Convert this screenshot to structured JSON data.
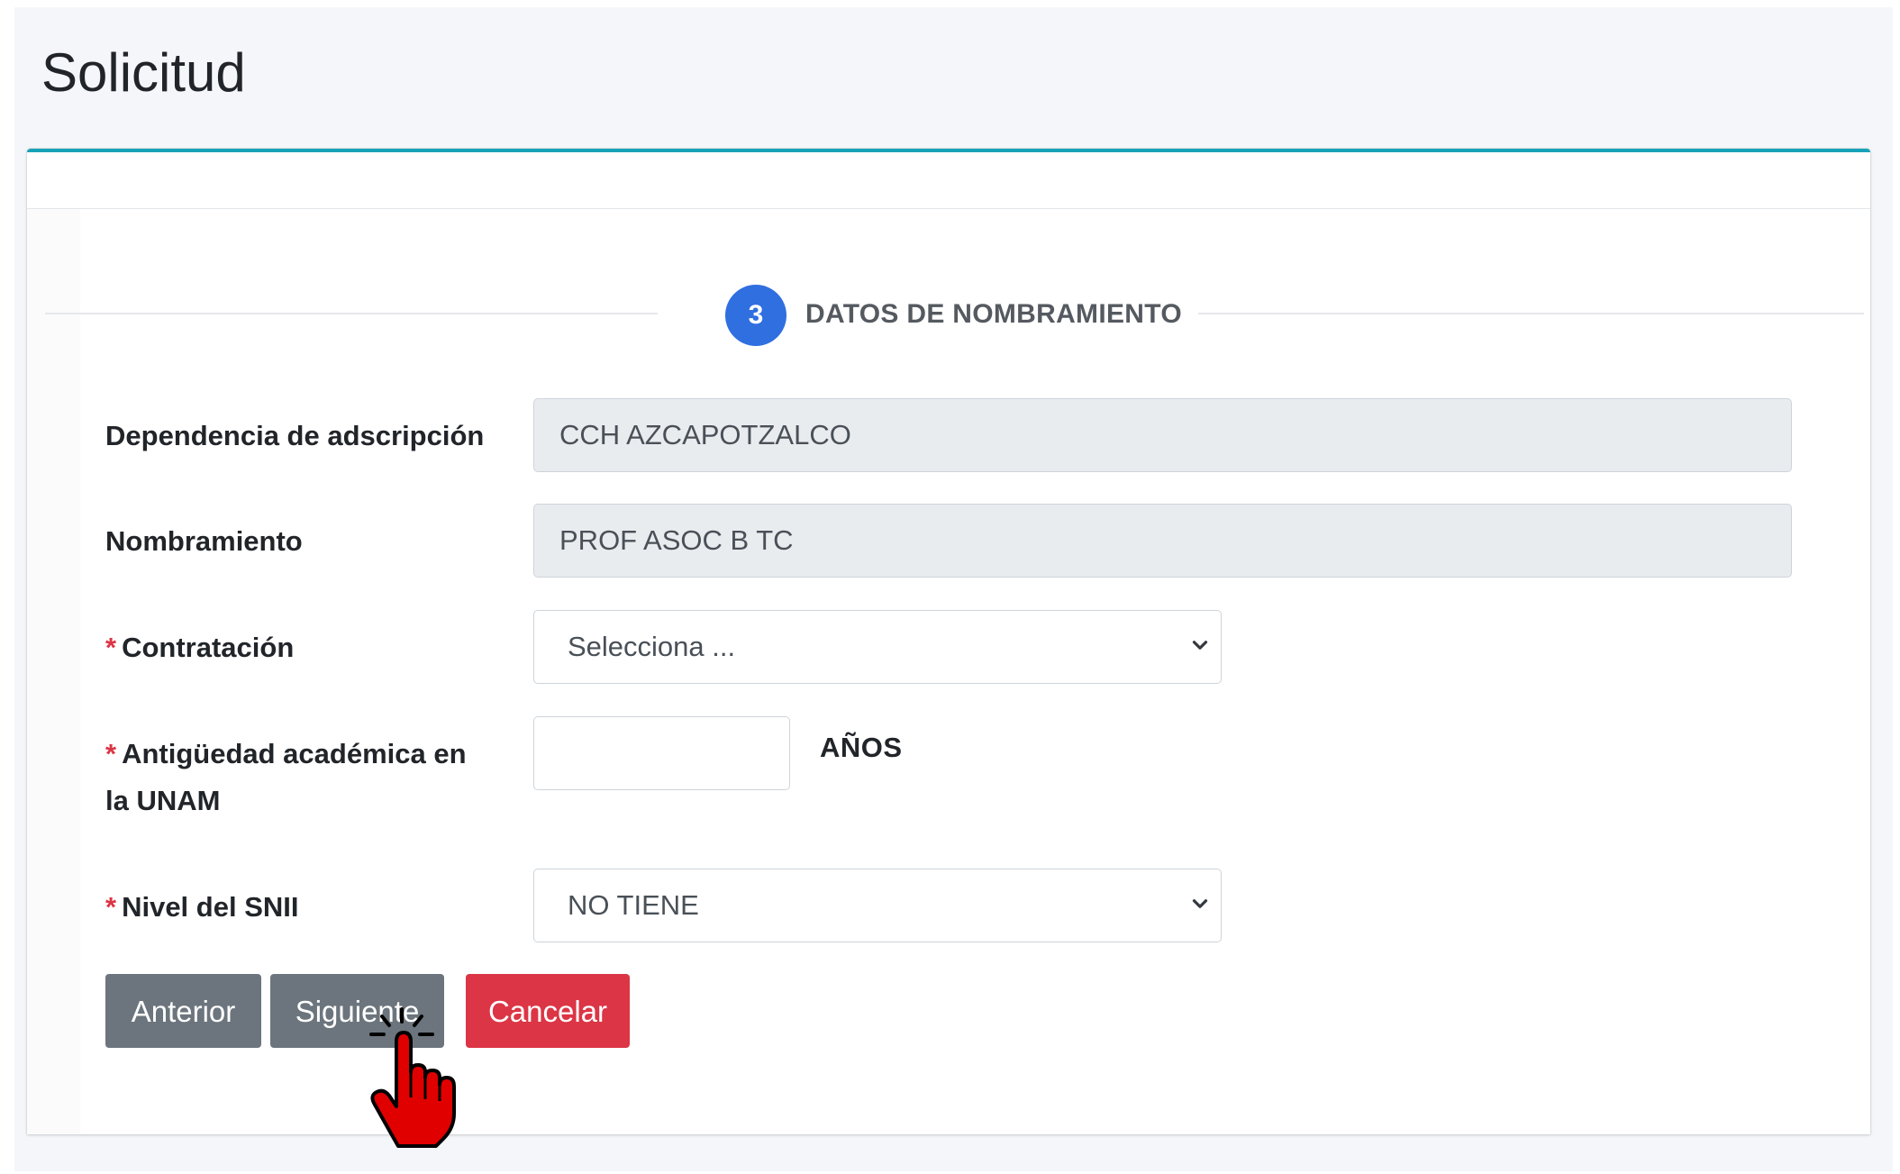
{
  "page": {
    "title": "Solicitud"
  },
  "step": {
    "number": "3",
    "label": "DATOS DE NOMBRAMIENTO"
  },
  "form": {
    "dependencia": {
      "label": "Dependencia de adscripción",
      "value": "CCH AZCAPOTZALCO"
    },
    "nombramiento": {
      "label": "Nombramiento",
      "value": "PROF ASOC B TC"
    },
    "contratacion": {
      "required_mark": "*",
      "label": "Contratación",
      "selected": "Selecciona ..."
    },
    "antiguedad": {
      "required_mark": "*",
      "label_line1": "Antigüedad académica en",
      "label_line2": "la UNAM",
      "value": "",
      "suffix": "AÑOS"
    },
    "nivel_snii": {
      "required_mark": "*",
      "label": "Nivel del SNII",
      "selected": "NO TIENE"
    }
  },
  "buttons": {
    "anterior": "Anterior",
    "siguiente": "Siguiente",
    "cancelar": "Cancelar"
  },
  "colors": {
    "card_accent": "#17a2b8",
    "step_badge": "#2f6fe0",
    "secondary_button": "#6c757d",
    "danger_button": "#dc3545",
    "required": "#dc3545",
    "cursor": "#e00000"
  },
  "icons": {
    "select_arrow": "chevron-down-icon",
    "cursor": "hand-pointer-icon"
  }
}
